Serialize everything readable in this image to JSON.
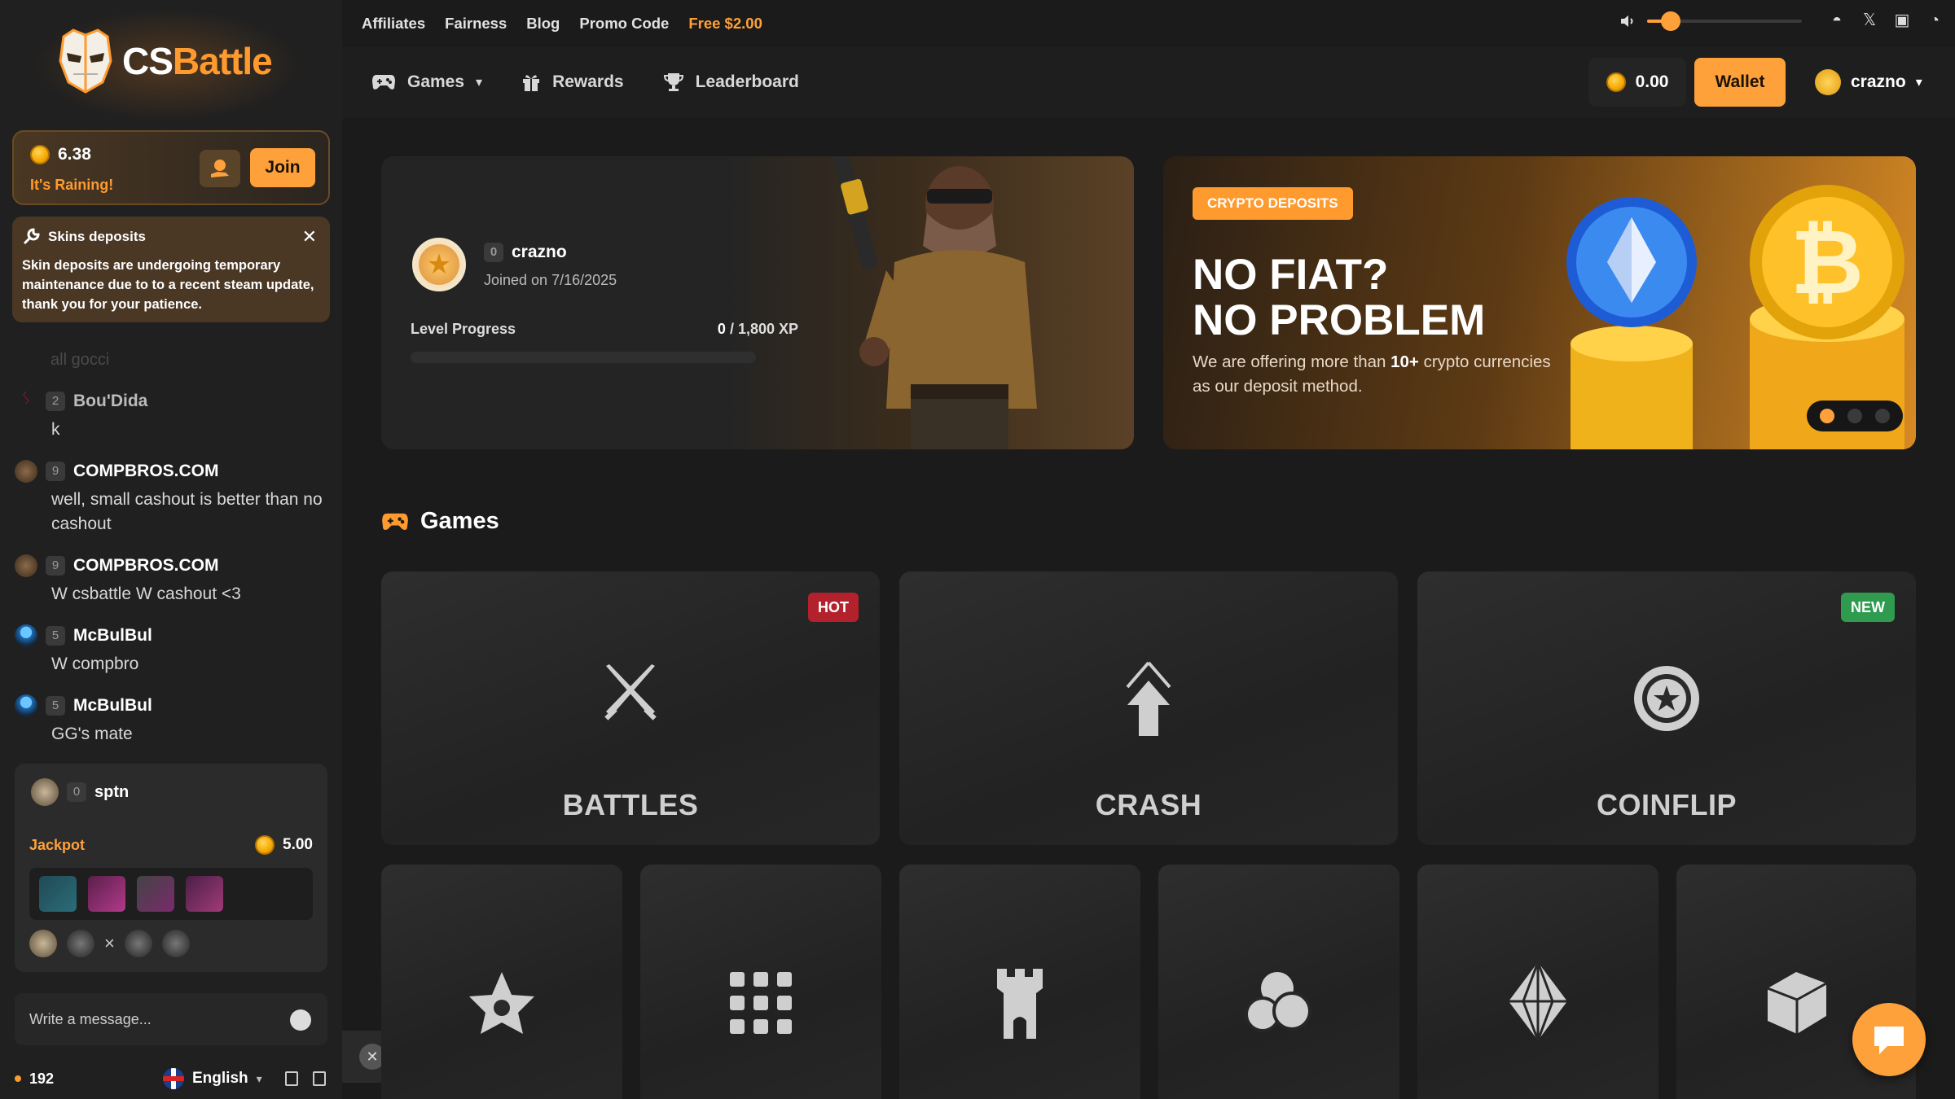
{
  "brand": {
    "logo_text_a": "CS",
    "logo_text_b": "Battle",
    "accent": "#ffa13a"
  },
  "topbar": {
    "links": [
      "Affiliates",
      "Fairness",
      "Blog",
      "Promo Code"
    ],
    "free_link": "Free $2.00",
    "volume_fraction": 0.15
  },
  "nav": {
    "items": [
      {
        "label": "Games",
        "icon": "gamepad-icon",
        "has_dropdown": true
      },
      {
        "label": "Rewards",
        "icon": "gift-icon"
      },
      {
        "label": "Leaderboard",
        "icon": "trophy-icon"
      }
    ],
    "balance": "0.00",
    "wallet_label": "Wallet",
    "username": "crazno"
  },
  "rain": {
    "amount": "6.38",
    "label": "It's Raining!",
    "join_label": "Join"
  },
  "notice": {
    "title": "Skins deposits",
    "text": "Skin deposits are undergoing temporary maintenance due to to a recent steam update, thank you for your patience."
  },
  "chat": {
    "faded_text": "all gocci",
    "messages": [
      {
        "level": "2",
        "user": "Bou'Dida",
        "text": "k"
      },
      {
        "level": "9",
        "user": "COMPBROS.COM",
        "text": "well, small cashout is better than no cashout"
      },
      {
        "level": "9",
        "user": "COMPBROS.COM",
        "text": "W csbattle W cashout <3"
      },
      {
        "level": "5",
        "user": "McBulBul",
        "text": "W compbro"
      },
      {
        "level": "5",
        "user": "McBulBul",
        "text": "GG's mate"
      }
    ],
    "jackpot": {
      "level": "0",
      "user": "sptn",
      "label": "Jackpot",
      "amount": "5.00",
      "versus": "×"
    },
    "input_placeholder": "Write a message...",
    "online_count": "192",
    "language": "English"
  },
  "profile": {
    "level": "0",
    "username": "crazno",
    "joined": "Joined on 7/16/2025",
    "progress_label": "Level Progress",
    "xp_current": "0",
    "xp_total": " / 1,800 XP",
    "progress_fraction": 0
  },
  "promo": {
    "tag": "CRYPTO DEPOSITS",
    "heading_line1": "NO FIAT?",
    "heading_line2": "NO PROBLEM",
    "text_a": "We are offering more than ",
    "text_b": "10+",
    "text_c": " crypto currencies as our deposit method.",
    "active_slide": 1,
    "slides": 3
  },
  "games": {
    "title": "Games",
    "featured": [
      {
        "name": "BATTLES",
        "badge": "HOT",
        "icon": "swords-icon"
      },
      {
        "name": "CRASH",
        "badge": "",
        "icon": "arrow-up-icon"
      },
      {
        "name": "COINFLIP",
        "badge": "NEW",
        "icon": "coin-icon"
      }
    ],
    "secondary_icons": [
      "star-hand-icon",
      "grid-dots-icon",
      "tower-icon",
      "coins-icon",
      "diamond-icon",
      "case-icon"
    ]
  }
}
